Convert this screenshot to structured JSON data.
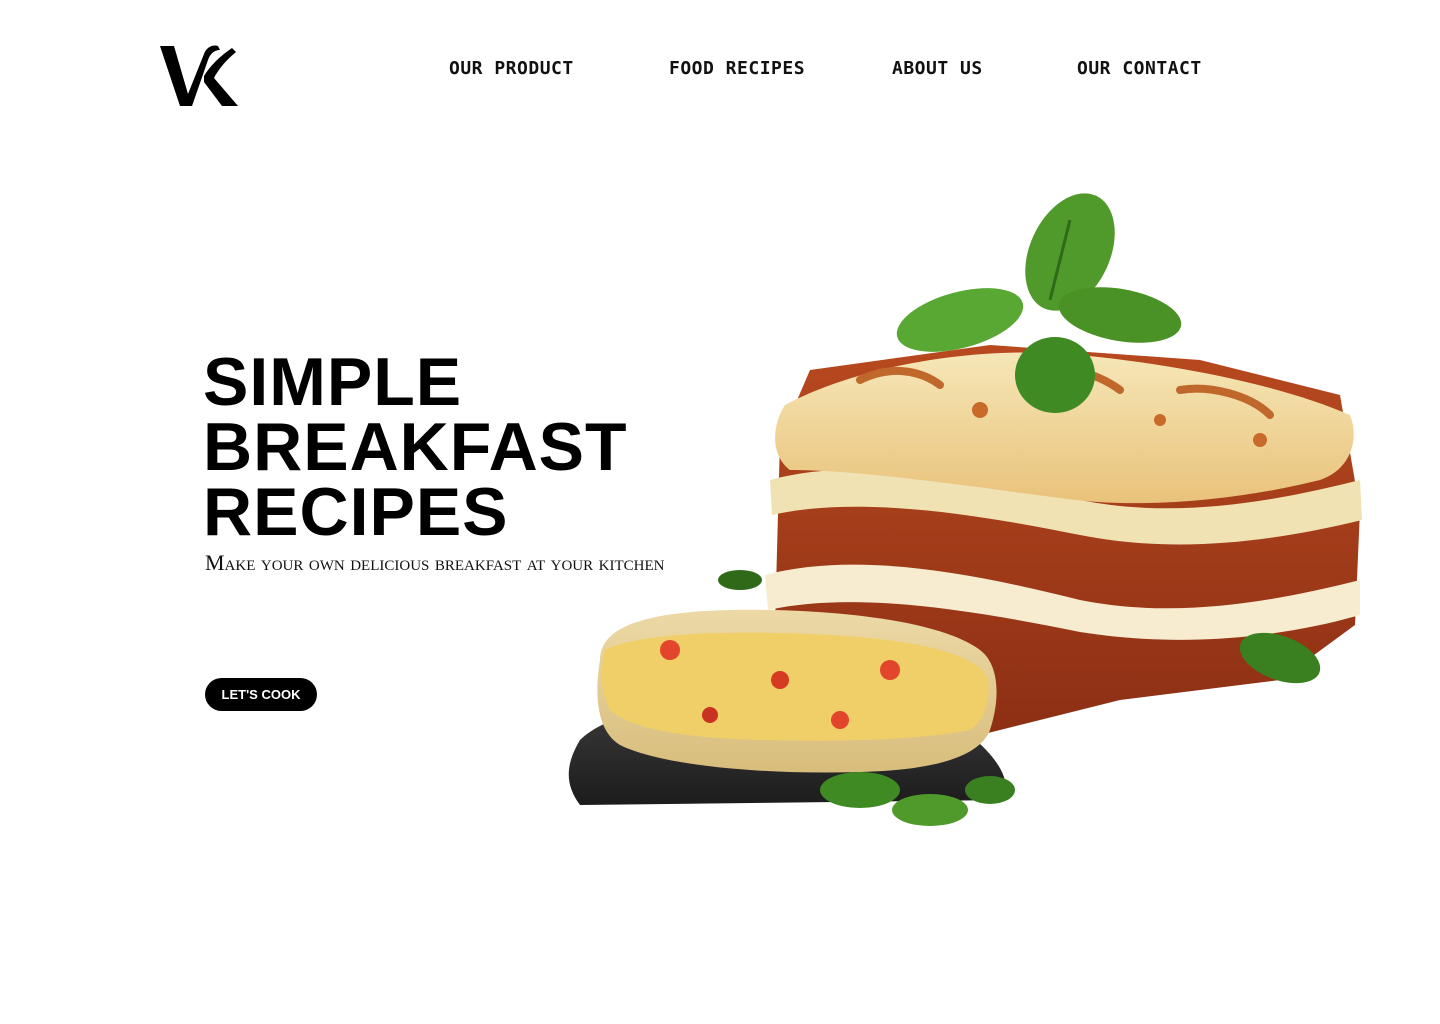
{
  "brand": {
    "logo_icon": "vk-monogram-logo-icon"
  },
  "nav": {
    "items": [
      {
        "label": "OUR PRODUCT"
      },
      {
        "label": "FOOD RECIPES"
      },
      {
        "label": "ABOUT US"
      },
      {
        "label": "OUR CONTACT"
      }
    ]
  },
  "hero": {
    "title_lines": [
      "SIMPLE",
      "BREAKFAST",
      "RECIPES"
    ],
    "subtitle": "Make your own delicious breakfast at your kitchen",
    "cta_label": "LET'S COOK"
  },
  "images": {
    "main": "lasagna-slice-with-basil-image",
    "secondary": "arepa-with-scrambled-eggs-on-slate-image"
  },
  "colors": {
    "accent": "#000000",
    "background": "#ffffff"
  }
}
